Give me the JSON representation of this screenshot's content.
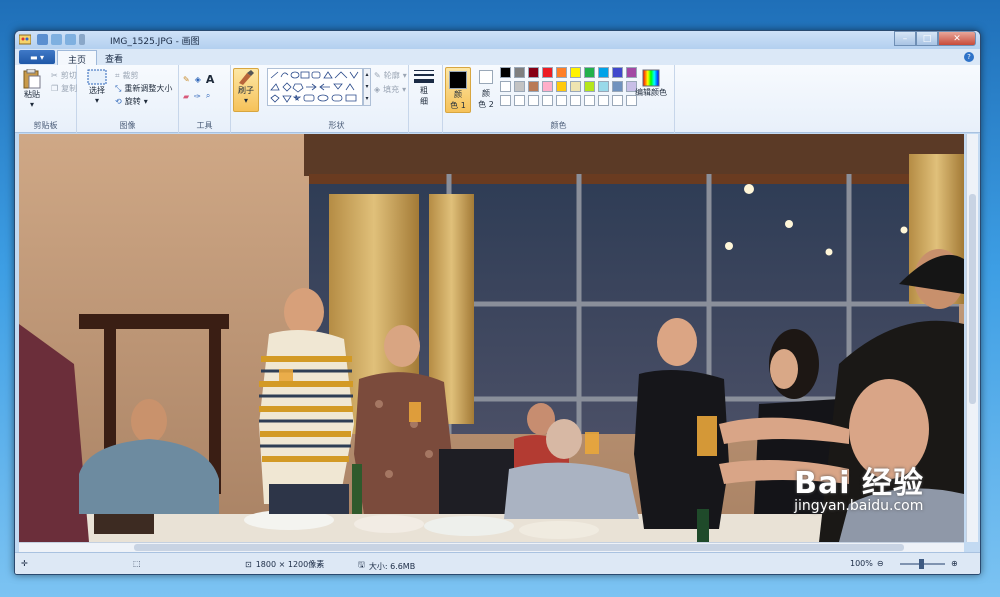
{
  "window": {
    "title": "IMG_1525.JPG - 画图"
  },
  "tabs": [
    {
      "label": "主页",
      "active": true
    },
    {
      "label": "查看",
      "active": false
    }
  ],
  "clipboard": {
    "group": "剪贴板",
    "paste": "粘贴",
    "cut": "剪切",
    "copy": "复制"
  },
  "image": {
    "group": "图像",
    "select": "选择",
    "crop": "裁剪",
    "resize": "重新调整大小",
    "rotate": "旋转"
  },
  "tools": {
    "group": "工具",
    "text_icon": "A"
  },
  "brushes": {
    "label": "刷子"
  },
  "shapes": {
    "group": "形状",
    "outline": "轮廓",
    "fill": "填充"
  },
  "size": {
    "label_line1": "粗",
    "label_line2": "细"
  },
  "colors": {
    "group": "颜色",
    "color1_line1": "颜",
    "color1_line2": "色 1",
    "color2_line1": "颜",
    "color2_line2": "色 2",
    "edit": "编辑颜色",
    "color1_value": "#000000",
    "color2_value": "#ffffff",
    "palette": [
      "#000000",
      "#7f7f7f",
      "#880015",
      "#ed1c24",
      "#ff7f27",
      "#fff200",
      "#22b14c",
      "#00a2e8",
      "#3f48cc",
      "#a349a4",
      "#ffffff",
      "#c3c3c3",
      "#b97a57",
      "#ffaec9",
      "#ffc90e",
      "#efe4b0",
      "#b5e61d",
      "#99d9ea",
      "#7092be",
      "#c8bfe7"
    ]
  },
  "status": {
    "dimensions": "1800 × 1200像素",
    "size": "大小: 6.6MB",
    "zoom": "100%"
  },
  "watermark": {
    "logo": "Bai 经验",
    "sub": "jingyan.baidu.com"
  }
}
